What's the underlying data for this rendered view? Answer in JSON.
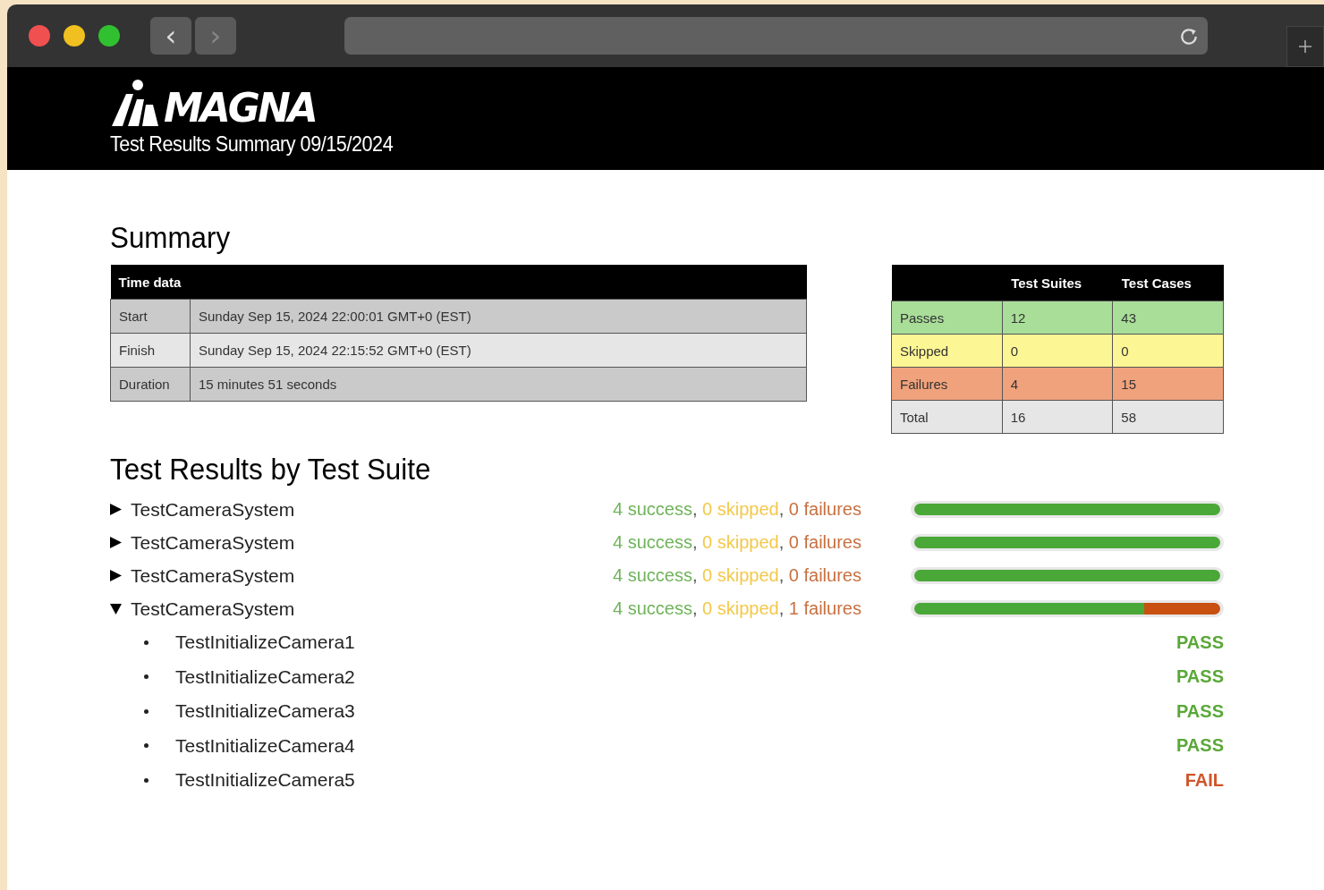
{
  "browser": {
    "back": "‹",
    "forward": "›"
  },
  "header": {
    "logo": "MAGNA",
    "subtitle": "Test Results Summary 09/15/2024"
  },
  "summary": {
    "title": "Summary",
    "time_table": {
      "heading": "Time data",
      "rows": [
        {
          "label": "Start",
          "value": "Sunday Sep 15, 2024 22:00:01 GMT+0 (EST)"
        },
        {
          "label": "Finish",
          "value": "Sunday Sep 15, 2024 22:15:52 GMT+0 (EST)"
        },
        {
          "label": "Duration",
          "value": "15 minutes 51 seconds"
        }
      ]
    },
    "stats_table": {
      "columns": [
        "Test Suites",
        "Test Cases"
      ],
      "rows": [
        {
          "kind": "passes",
          "label": "Passes",
          "suites": "12",
          "cases": "43"
        },
        {
          "kind": "skipped",
          "label": "Skipped",
          "suites": "0",
          "cases": "0"
        },
        {
          "kind": "failures",
          "label": "Failures",
          "suites": "4",
          "cases": "15"
        },
        {
          "kind": "total",
          "label": "Total",
          "suites": "16",
          "cases": "58"
        }
      ]
    }
  },
  "results": {
    "title": "Test Results by Test Suite",
    "suites": [
      {
        "name": "TestCameraSystem",
        "expanded": false,
        "success": "4 success",
        "separator": ",",
        "skipped": "0 skipped",
        "failures": "0 failures",
        "level": 1
      },
      {
        "name": "TestCameraSystem",
        "expanded": false,
        "success": "4 success",
        "separator": ",",
        "skipped": "0 skipped",
        "failures": "0 failures",
        "level": 1
      },
      {
        "name": "TestCameraSystem",
        "expanded": false,
        "success": "4 success",
        "separator": ",",
        "skipped": "0 skipped",
        "failures": "0 failures",
        "level": 1
      },
      {
        "name": "TestCameraSystem",
        "expanded": true,
        "success": "4 success",
        "separator": ",",
        "skipped": "0 skipped",
        "failures": "1 failures",
        "level": 0.75,
        "children": [
          {
            "name": "TestInitializeCamera1",
            "kind": "pass",
            "result": "PASS"
          },
          {
            "name": "TestInitializeCamera2",
            "kind": "pass",
            "result": "PASS"
          },
          {
            "name": "TestInitializeCamera3",
            "kind": "pass",
            "result": "PASS"
          },
          {
            "name": "TestInitializeCamera4",
            "kind": "pass",
            "result": "PASS"
          },
          {
            "name": "TestInitializeCamera5",
            "kind": "fail",
            "result": "FAIL"
          }
        ]
      }
    ]
  }
}
